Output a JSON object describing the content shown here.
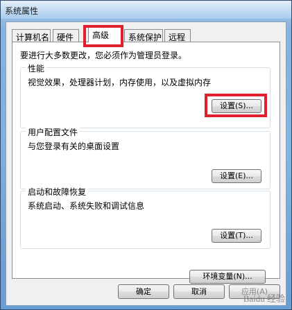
{
  "window": {
    "title": "系统属性"
  },
  "tabs": [
    {
      "label": "计算机名"
    },
    {
      "label": "硬件"
    },
    {
      "label": "高级"
    },
    {
      "label": "系统保护"
    },
    {
      "label": "远程"
    }
  ],
  "advanced": {
    "notice": "要进行大多数更改，您必须作为管理员登录。",
    "performance": {
      "title": "性能",
      "desc": "视觉效果，处理器计划，内存使用，以及虚拟内存",
      "button": "设置(S)..."
    },
    "user_profiles": {
      "title": "用户配置文件",
      "desc": "与您登录有关的桌面设置",
      "button": "设置(E)..."
    },
    "startup_recovery": {
      "title": "启动和故障恢复",
      "desc": "系统启动、系统失败和调试信息",
      "button": "设置(T)..."
    },
    "env_button": "环境变量(N)..."
  },
  "footer": {
    "ok": "确定",
    "cancel": "取消",
    "apply": "应用(A)"
  },
  "watermark": "Baidu 经验",
  "colors": {
    "highlight": "#e0202f"
  }
}
